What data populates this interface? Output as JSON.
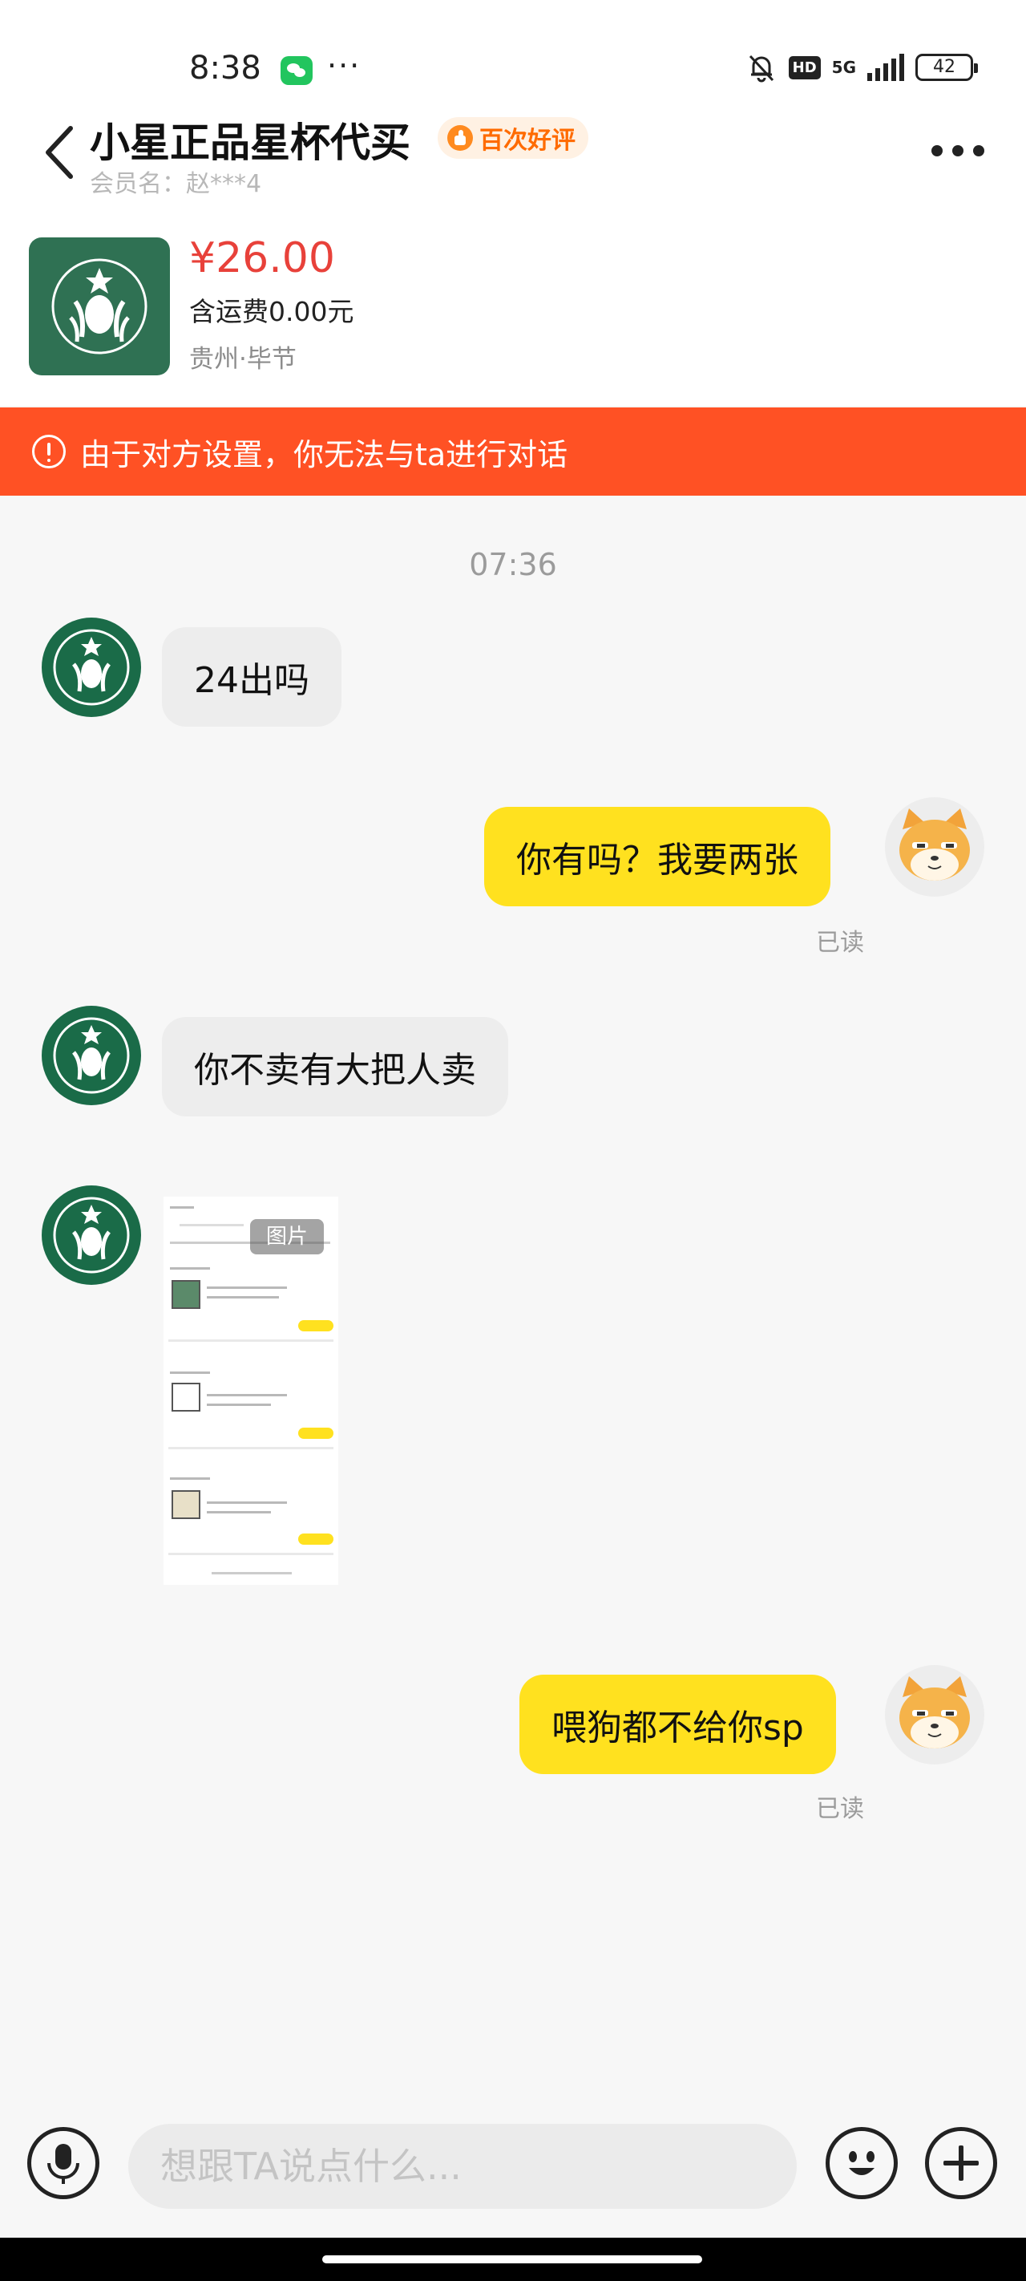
{
  "status_bar": {
    "time": "8:38",
    "dots": "···",
    "hd": "HD",
    "network": "5G",
    "battery": "42"
  },
  "header": {
    "seller_name": "小星正品星杯代买",
    "rating_badge": "百次好评",
    "member_label": "会员名：赵***4"
  },
  "product": {
    "price": "¥26.00",
    "shipping": "含运费0.00元",
    "location": "贵州·毕节"
  },
  "warning": {
    "text": "由于对方设置，你无法与ta进行对话",
    "color": "#ff5124"
  },
  "chat": {
    "timestamp": "07:36",
    "messages": [
      {
        "side": "in",
        "text": "24出吗"
      },
      {
        "side": "out",
        "text": "你有吗？我要两张",
        "status": "已读"
      },
      {
        "side": "in",
        "text": "你不卖有大把人卖"
      },
      {
        "side": "in",
        "type": "image",
        "label": "图片"
      },
      {
        "side": "out",
        "text": "喂狗都不给你sp",
        "status": "已读"
      }
    ]
  },
  "input": {
    "placeholder": "想跟TA说点什么..."
  },
  "colors": {
    "accent_yellow": "#ffe11f",
    "price_red": "#e8413a",
    "badge_orange": "#ff6b00",
    "starbucks_green": "#1a6b48"
  },
  "icons": [
    "back-arrow-icon",
    "more-icon",
    "wechat-icon",
    "bell-off-icon",
    "mic-icon",
    "emoji-icon",
    "plus-icon",
    "alert-icon",
    "thumbs-up-icon"
  ]
}
